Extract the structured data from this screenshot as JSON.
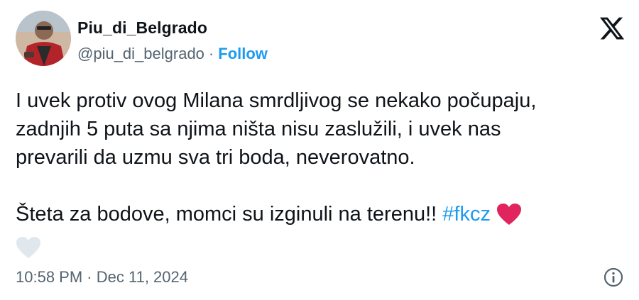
{
  "author": {
    "display_name": "Piu_di_Belgrado",
    "handle": "@piu_di_belgrado",
    "separator": "·",
    "follow_label": "Follow"
  },
  "tweet": {
    "lines": [
      "I uvek protiv ovog Milana smrdljivog se nekako počupaju,",
      "zadnjih 5 puta sa njima ništa nisu zaslužili, i uvek nas",
      "prevarili da uzmu sva tri boda, neverovatno."
    ],
    "line2_text": "Šteta za bodove, momci su izginuli na terenu!!",
    "hashtag": "#fkcz",
    "emojis": [
      "red-heart",
      "white-heart"
    ]
  },
  "meta": {
    "time": "10:58 PM",
    "separator": "·",
    "date": "Dec 11, 2024"
  },
  "icons": {
    "brand": "x-logo-icon",
    "info": "info-icon"
  },
  "colors": {
    "text": "#0f1419",
    "secondary": "#536471",
    "accent": "#1d9bf0",
    "heart_red": "#e0245e",
    "heart_white": "#e1e8ed"
  }
}
